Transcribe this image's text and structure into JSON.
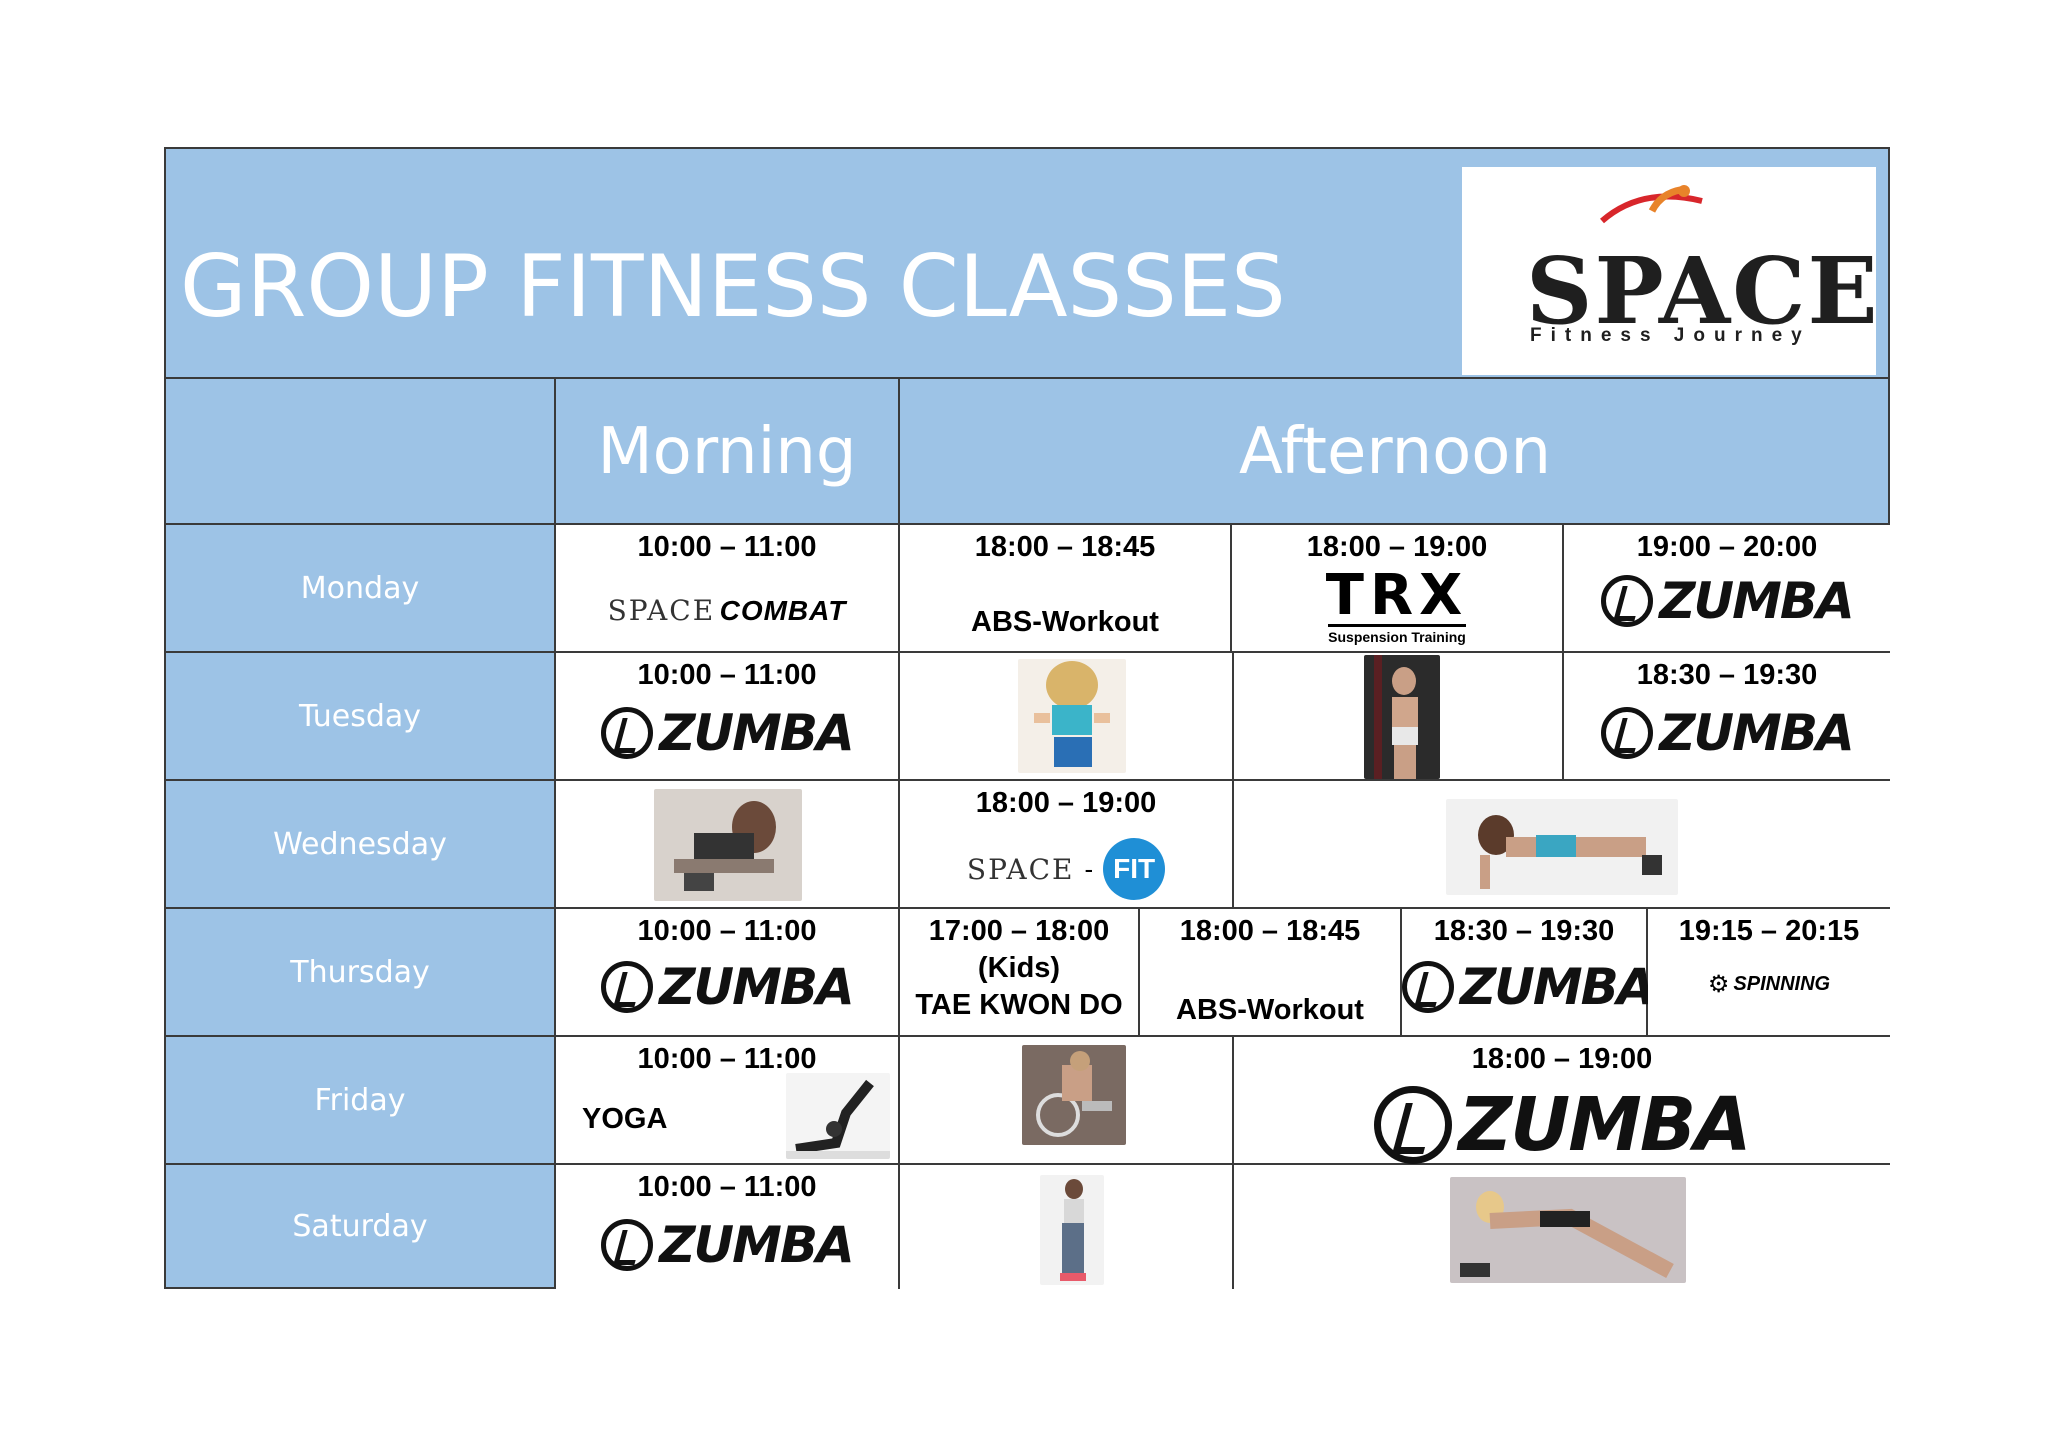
{
  "title": "GROUP FITNESS CLASSES",
  "logo": {
    "word": "SPACE",
    "tagline": "Fitness Journey"
  },
  "headers": {
    "morning": "Morning",
    "afternoon": "Afternoon"
  },
  "days": [
    "Monday",
    "Tuesday",
    "Wednesday",
    "Thursday",
    "Friday",
    "Saturday"
  ],
  "monday": {
    "c1_time": "10:00 – 11:00",
    "c1_brand_a": "SPACE",
    "c1_brand_b": "COMBAT",
    "c2_time": "18:00 – 18:45",
    "c2_label": "ABS-Workout",
    "c3_time": "18:00 – 19:00",
    "c3_brand": "TRX",
    "c3_sub": "Suspension Training",
    "c4_time": "19:00 – 20:00",
    "c4_brand": "ZUMBA"
  },
  "tuesday": {
    "c1_time": "10:00 – 11:00",
    "c1_brand": "ZUMBA",
    "c4_time": "18:30 – 19:30",
    "c4_brand": "ZUMBA"
  },
  "wednesday": {
    "c2_time": "18:00 – 19:00",
    "c2_brand_a": "SPACE",
    "c2_brand_b": "FIT"
  },
  "thursday": {
    "c1_time": "10:00 – 11:00",
    "c1_brand": "ZUMBA",
    "c2_time": "17:00 – 18:00",
    "c2_sub": "(Kids)",
    "c2_label": "TAE KWON DO",
    "c3_time": "18:00 – 18:45",
    "c3_label": "ABS-Workout",
    "c4_time": "18:30 – 19:30",
    "c4_brand": "ZUMBA",
    "c5_time": "19:15 – 20:15",
    "c5_brand": "SPINNING"
  },
  "friday": {
    "c1_time": "10:00 – 11:00",
    "c1_label": "YOGA",
    "c3_time": "18:00 – 19:00",
    "c3_brand": "ZUMBA"
  },
  "saturday": {
    "c1_time": "10:00 – 11:00",
    "c1_brand": "ZUMBA"
  },
  "colors": {
    "band": "#9dc3e6",
    "border": "#3a3a3a",
    "logo_accent": "#e8832a",
    "fit_badge": "#1f8fd6"
  },
  "icons": [
    "zumba-logo-icon",
    "trx-logo",
    "spinning-icon",
    "space-logo"
  ]
}
